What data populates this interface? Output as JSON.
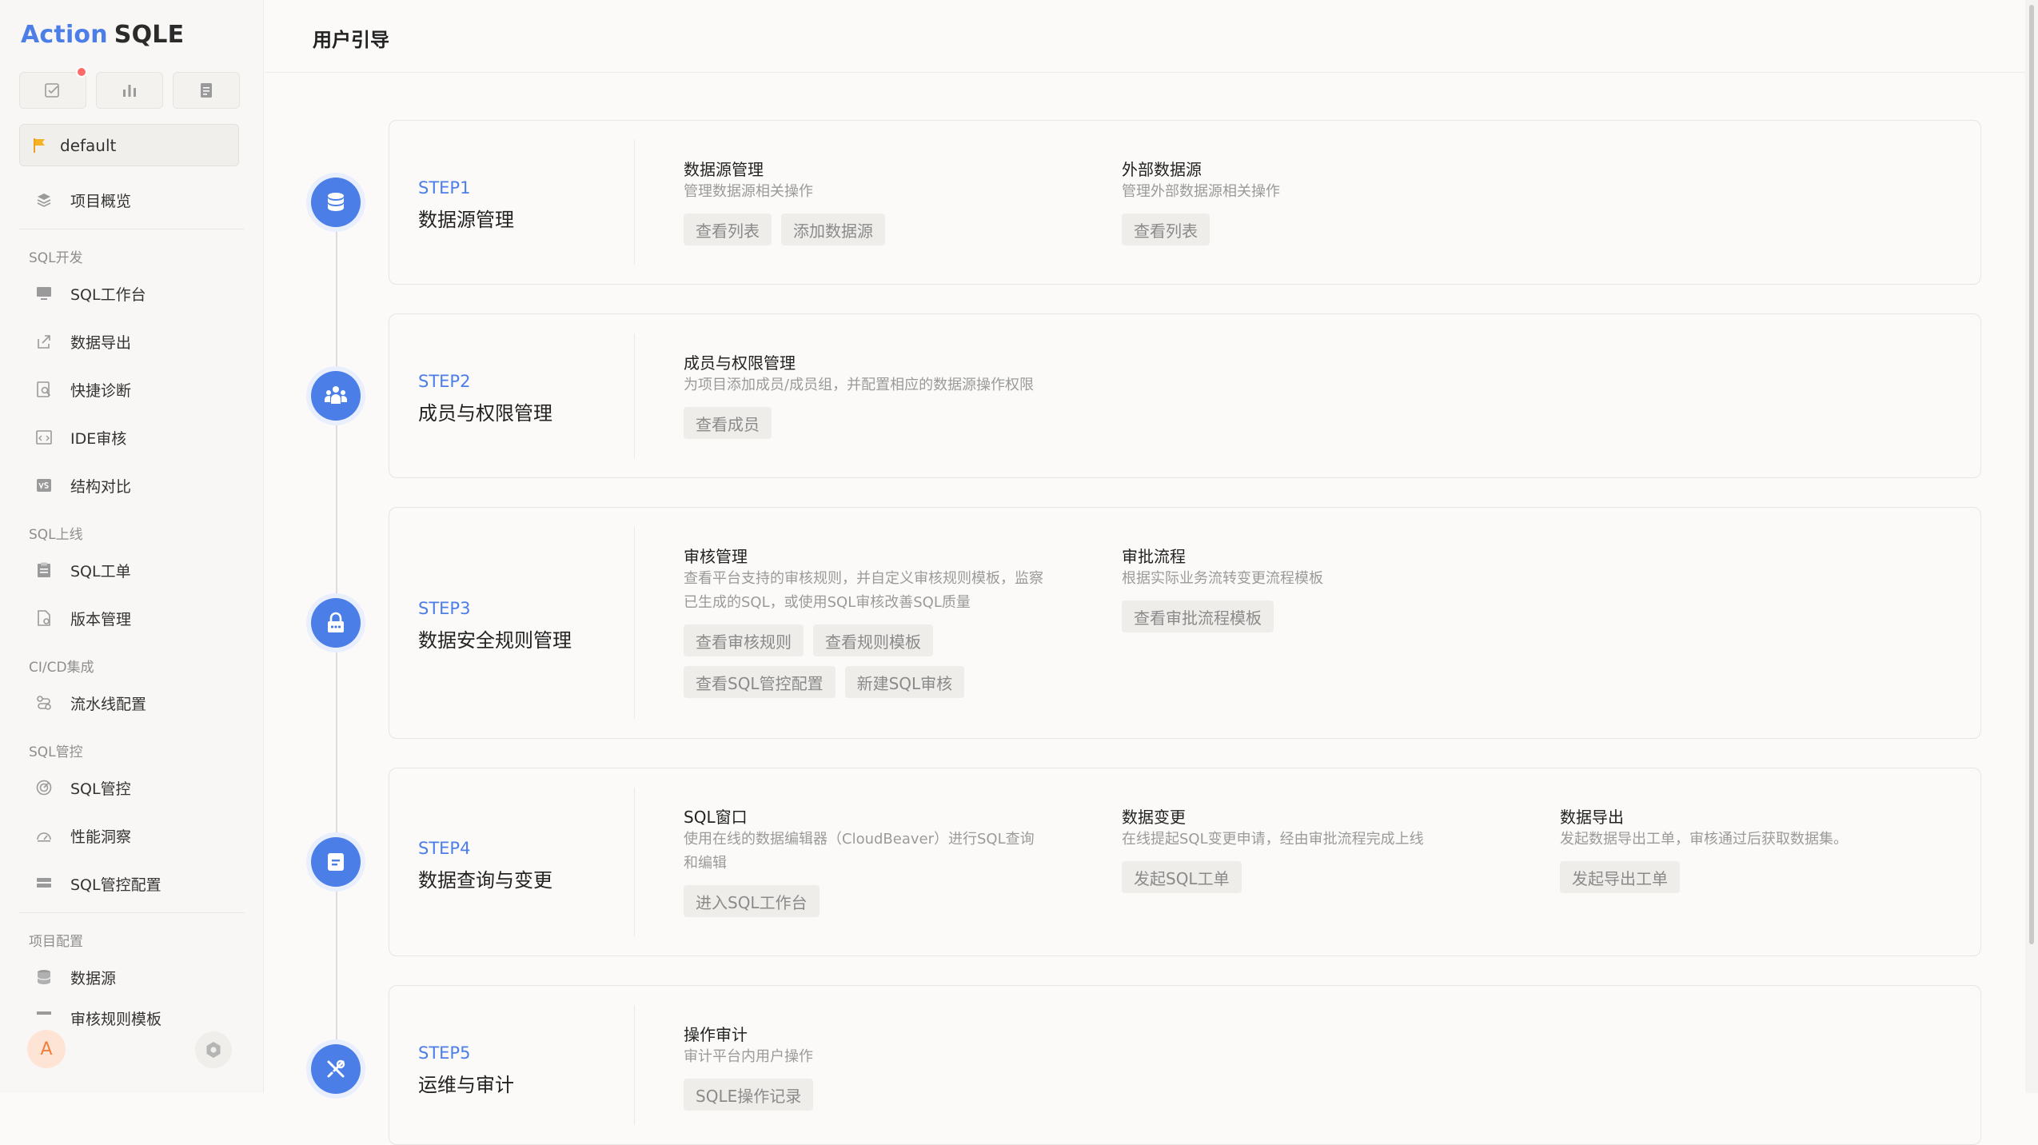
{
  "app": {
    "logo_part1": "Action",
    "logo_part2": "SQLE"
  },
  "project": {
    "name": "default"
  },
  "sidebar": {
    "overview": "项目概览",
    "groups": [
      {
        "label": "SQL开发",
        "items": [
          "SQL工作台",
          "数据导出",
          "快捷诊断",
          "IDE审核",
          "结构对比"
        ]
      },
      {
        "label": "SQL上线",
        "items": [
          "SQL工单",
          "版本管理"
        ]
      },
      {
        "label": "CI/CD集成",
        "items": [
          "流水线配置"
        ]
      },
      {
        "label": "SQL管控",
        "items": [
          "SQL管控",
          "性能洞察",
          "SQL管控配置"
        ]
      },
      {
        "label": "项目配置",
        "items": [
          "数据源",
          "审核规则模板"
        ]
      }
    ]
  },
  "user": {
    "avatar_initial": "A"
  },
  "header": {
    "title": "用户引导"
  },
  "steps": [
    {
      "label": "STEP1",
      "title": "数据源管理",
      "sections": [
        {
          "title": "数据源管理",
          "desc": [
            "管理数据源相关操作"
          ],
          "buttons": [
            [
              "查看列表",
              "添加数据源"
            ]
          ]
        },
        {
          "title": "外部数据源",
          "desc": [
            "管理外部数据源相关操作"
          ],
          "buttons": [
            [
              "查看列表"
            ]
          ]
        }
      ]
    },
    {
      "label": "STEP2",
      "title": "成员与权限管理",
      "sections": [
        {
          "title": "成员与权限管理",
          "desc": [
            "为项目添加成员/成员组，并配置相应的数据源操作权限"
          ],
          "buttons": [
            [
              "查看成员"
            ]
          ]
        }
      ]
    },
    {
      "label": "STEP3",
      "title": "数据安全规则管理",
      "sections": [
        {
          "title": "审核管理",
          "desc": [
            "查看平台支持的审核规则，并自定义审核规则模板，监察",
            "已生成的SQL，或使用SQL审核改善SQL质量"
          ],
          "buttons": [
            [
              "查看审核规则",
              "查看规则模板"
            ],
            [
              "查看SQL管控配置",
              "新建SQL审核"
            ]
          ]
        },
        {
          "title": "审批流程",
          "desc": [
            "根据实际业务流转变更流程模板"
          ],
          "buttons": [
            [
              "查看审批流程模板"
            ]
          ]
        }
      ]
    },
    {
      "label": "STEP4",
      "title": "数据查询与变更",
      "sections": [
        {
          "title": "SQL窗口",
          "desc": [
            "使用在线的数据编辑器（CloudBeaver）进行SQL查询",
            "和编辑"
          ],
          "buttons": [
            [
              "进入SQL工作台"
            ]
          ]
        },
        {
          "title": "数据变更",
          "desc": [
            "在线提起SQL变更申请，经由审批流程完成上线"
          ],
          "buttons": [
            [
              "发起SQL工单"
            ]
          ]
        },
        {
          "title": "数据导出",
          "desc": [
            "发起数据导出工单，审核通过后获取数据集。"
          ],
          "buttons": [
            [
              "发起导出工单"
            ]
          ]
        }
      ]
    },
    {
      "label": "STEP5",
      "title": "运维与审计",
      "sections": [
        {
          "title": "操作审计",
          "desc": [
            "审计平台内用户操作"
          ],
          "buttons": [
            [
              "SQLE操作记录"
            ]
          ]
        }
      ]
    }
  ],
  "colors": {
    "accent": "#4c7ee8",
    "badge": "#ff6b6b"
  }
}
